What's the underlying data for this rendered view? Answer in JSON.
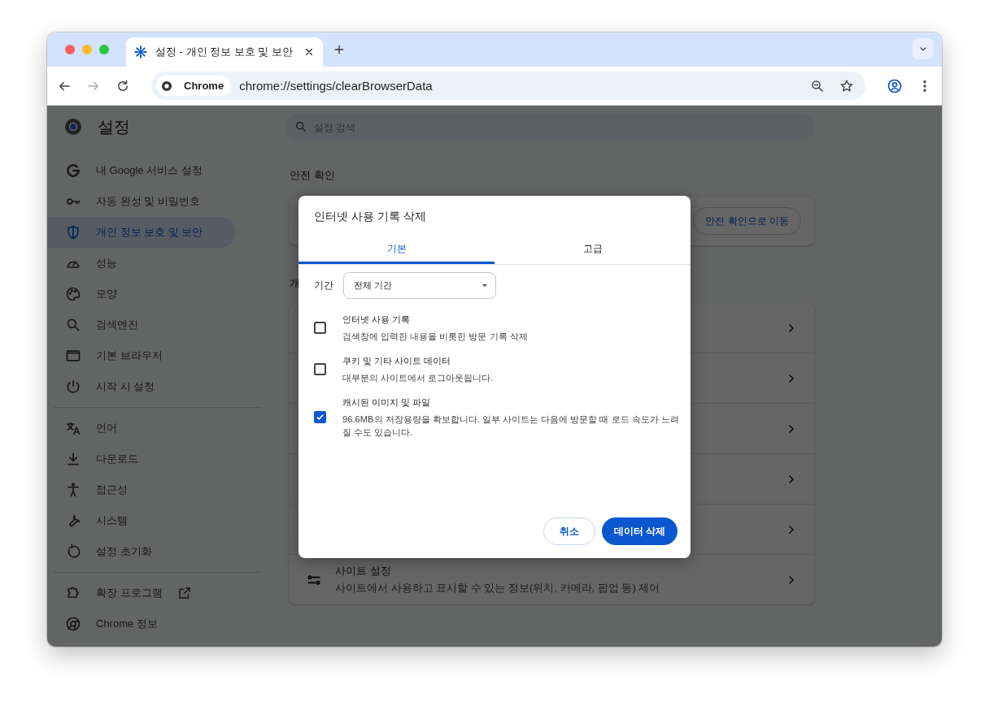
{
  "browser": {
    "tab_title": "설정 - 개인 정보 보호 및 보안",
    "site_chip": "Chrome",
    "url": "chrome://settings/clearBrowserData"
  },
  "sidebar": {
    "title": "설정",
    "groups": [
      {
        "items": [
          {
            "label": "내 Google 서비스 설정",
            "selected": false,
            "external": false
          },
          {
            "label": "자동 완성 및 비밀번호",
            "selected": false,
            "external": false
          },
          {
            "label": "개인 정보 보호 및 보안",
            "selected": true,
            "external": false
          },
          {
            "label": "성능",
            "selected": false,
            "external": false
          },
          {
            "label": "모양",
            "selected": false,
            "external": false
          },
          {
            "label": "검색엔진",
            "selected": false,
            "external": false
          },
          {
            "label": "기본 브라우저",
            "selected": false,
            "external": false
          },
          {
            "label": "시작 시 설정",
            "selected": false,
            "external": false
          }
        ]
      },
      {
        "items": [
          {
            "label": "언어",
            "selected": false,
            "external": false
          },
          {
            "label": "다운로드",
            "selected": false,
            "external": false
          },
          {
            "label": "접근성",
            "selected": false,
            "external": false
          },
          {
            "label": "시스템",
            "selected": false,
            "external": false
          },
          {
            "label": "설정 초기화",
            "selected": false,
            "external": false
          }
        ]
      },
      {
        "items": [
          {
            "label": "확장 프로그램",
            "selected": false,
            "external": true
          },
          {
            "label": "Chrome 정보",
            "selected": false,
            "external": false
          }
        ]
      }
    ]
  },
  "main": {
    "search": {
      "placeholder": "설정 검색"
    },
    "safety": {
      "heading": "안전 확인",
      "button": "안전 확인으로 이동"
    },
    "privacy": {
      "heading": "개",
      "rows": [
        {
          "kind": "covered"
        },
        {
          "kind": "covered"
        },
        {
          "kind": "covered"
        },
        {
          "kind": "covered"
        },
        {
          "kind": "covered"
        },
        {
          "kind": "site",
          "title": "사이트 설정",
          "description": "사이트에서 사용하고 표시할 수 있는 정보(위치, 카메라, 팝업 등) 제어"
        }
      ]
    }
  },
  "dialog": {
    "title": "인터넷 사용 기록 삭제",
    "tabs": [
      {
        "label": "기본",
        "selected": true
      },
      {
        "label": "고급",
        "selected": false
      }
    ],
    "period": {
      "label": "기간",
      "value": "전체 기간"
    },
    "options": [
      {
        "title": "인터넷 사용 기록",
        "description": "검색창에 입력한 내용을 비롯한 방문 기록 삭제",
        "checked": false
      },
      {
        "title": "쿠키 및 기타 사이트 데이터",
        "description": "대부분의 사이트에서 로그아웃됩니다.",
        "checked": false
      },
      {
        "title": "캐시된 이미지 및 파일",
        "description": "96.6MB의 저장용량을 확보합니다. 일부 사이트는 다음에 방문할 때 로드 속도가 느려질 수도 있습니다.",
        "checked": true
      }
    ],
    "cancel": "취소",
    "confirm": "데이터 삭제"
  }
}
